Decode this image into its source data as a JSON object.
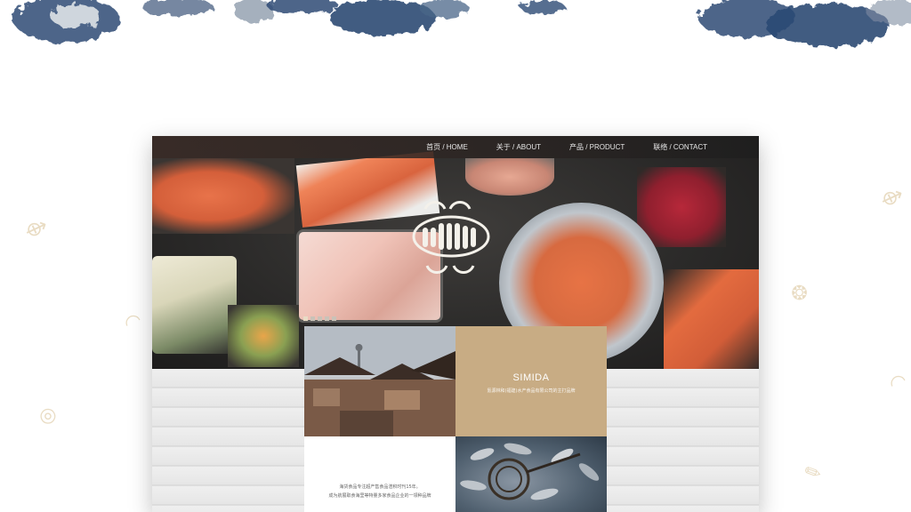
{
  "nav": {
    "items": [
      {
        "label": "首页 / HOME"
      },
      {
        "label": "关于 / ABOUT"
      },
      {
        "label": "产品 / PRODUCT"
      },
      {
        "label": "联络 / CONTACT"
      }
    ]
  },
  "brand": {
    "title": "SIMIDA",
    "subtitle": "氪源林和(福建)水产食品有限公司的主打品牌"
  },
  "about": {
    "line1": "海货食品专注超产售食品渲积时刊15年。",
    "line2": "成为航展取食海里等特量多家食品企业的一领种品牌"
  },
  "colors": {
    "brand_card": "#c8ac84",
    "nav_bg": "#2e2b29",
    "splash_blue": "#2d4a74"
  }
}
